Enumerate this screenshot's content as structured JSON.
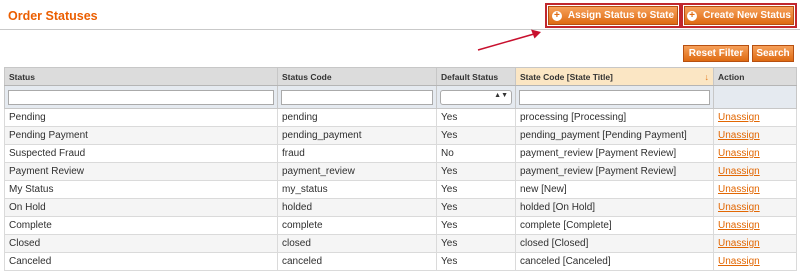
{
  "header": {
    "title": "Order Statuses",
    "assign_label": "Assign Status to State",
    "create_label": "Create New Status"
  },
  "actions": {
    "reset_filter": "Reset Filter",
    "search": "Search"
  },
  "grid": {
    "columns": [
      "Status",
      "Status Code",
      "Default Status",
      "State Code [State Title]",
      "Action"
    ],
    "rows": [
      {
        "status": "Pending",
        "code": "pending",
        "default": "Yes",
        "state": "processing [Processing]",
        "action": "Unassign"
      },
      {
        "status": "Pending Payment",
        "code": "pending_payment",
        "default": "Yes",
        "state": "pending_payment [Pending Payment]",
        "action": "Unassign"
      },
      {
        "status": "Suspected Fraud",
        "code": "fraud",
        "default": "No",
        "state": "payment_review [Payment Review]",
        "action": "Unassign"
      },
      {
        "status": "Payment Review",
        "code": "payment_review",
        "default": "Yes",
        "state": "payment_review [Payment Review]",
        "action": "Unassign"
      },
      {
        "status": "My Status",
        "code": "my_status",
        "default": "Yes",
        "state": "new [New]",
        "action": "Unassign"
      },
      {
        "status": "On Hold",
        "code": "holded",
        "default": "Yes",
        "state": "holded [On Hold]",
        "action": "Unassign"
      },
      {
        "status": "Complete",
        "code": "complete",
        "default": "Yes",
        "state": "complete [Complete]",
        "action": "Unassign"
      },
      {
        "status": "Closed",
        "code": "closed",
        "default": "Yes",
        "state": "closed [Closed]",
        "action": "Unassign"
      },
      {
        "status": "Canceled",
        "code": "canceled",
        "default": "Yes",
        "state": "canceled [Canceled]",
        "action": "Unassign"
      }
    ]
  },
  "colors": {
    "accent": "#eb5e00",
    "highlight_box": "#c1272d",
    "link": "#e26703"
  }
}
